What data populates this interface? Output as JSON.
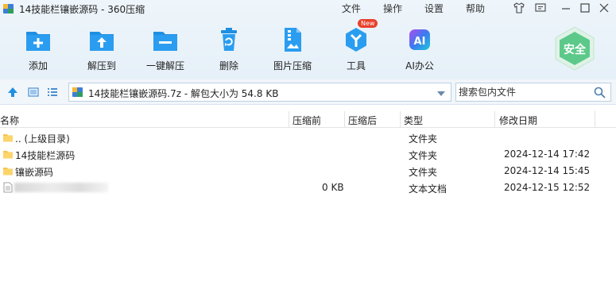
{
  "window": {
    "title": "14技能栏镶嵌源码 - 360压缩",
    "menu": [
      "文件",
      "操作",
      "设置",
      "帮助"
    ]
  },
  "toolbar": {
    "items": [
      {
        "label": "添加",
        "icon": "add-icon"
      },
      {
        "label": "解压到",
        "icon": "extract-to-icon"
      },
      {
        "label": "一键解压",
        "icon": "one-click-extract-icon"
      },
      {
        "label": "删除",
        "icon": "delete-icon"
      },
      {
        "label": "图片压缩",
        "icon": "image-compress-icon"
      },
      {
        "label": "工具",
        "icon": "tools-icon",
        "badge": "New"
      },
      {
        "label": "AI办公",
        "icon": "ai-office-icon"
      }
    ],
    "safe_label": "安全"
  },
  "address": {
    "path": "14技能栏镶嵌源码.7z - 解包大小为 54.8 KB",
    "search_placeholder": "搜索包内文件"
  },
  "list": {
    "columns": [
      "名称",
      "压缩前",
      "压缩后",
      "类型",
      "修改日期"
    ],
    "rows": [
      {
        "name": ".. (上级目录)",
        "size": "",
        "packed": "",
        "type": "文件夹",
        "modified": "",
        "icon": "folder-icon"
      },
      {
        "name": "14技能栏源码",
        "size": "",
        "packed": "",
        "type": "文件夹",
        "modified": "2024-12-14 17:42",
        "icon": "folder-icon"
      },
      {
        "name": "镶嵌源码",
        "size": "",
        "packed": "",
        "type": "文件夹",
        "modified": "2024-12-14 15:45",
        "icon": "folder-icon"
      },
      {
        "name": "",
        "size": "0 KB",
        "packed": "",
        "type": "文本文档",
        "modified": "2024-12-15 12:52",
        "icon": "text-file-icon"
      }
    ]
  },
  "colors": {
    "accent": "#1e8fe1",
    "toolbar_bg": "#eaf2f9",
    "safe_green": "#5cc98a",
    "badge_red": "#e8412c"
  }
}
